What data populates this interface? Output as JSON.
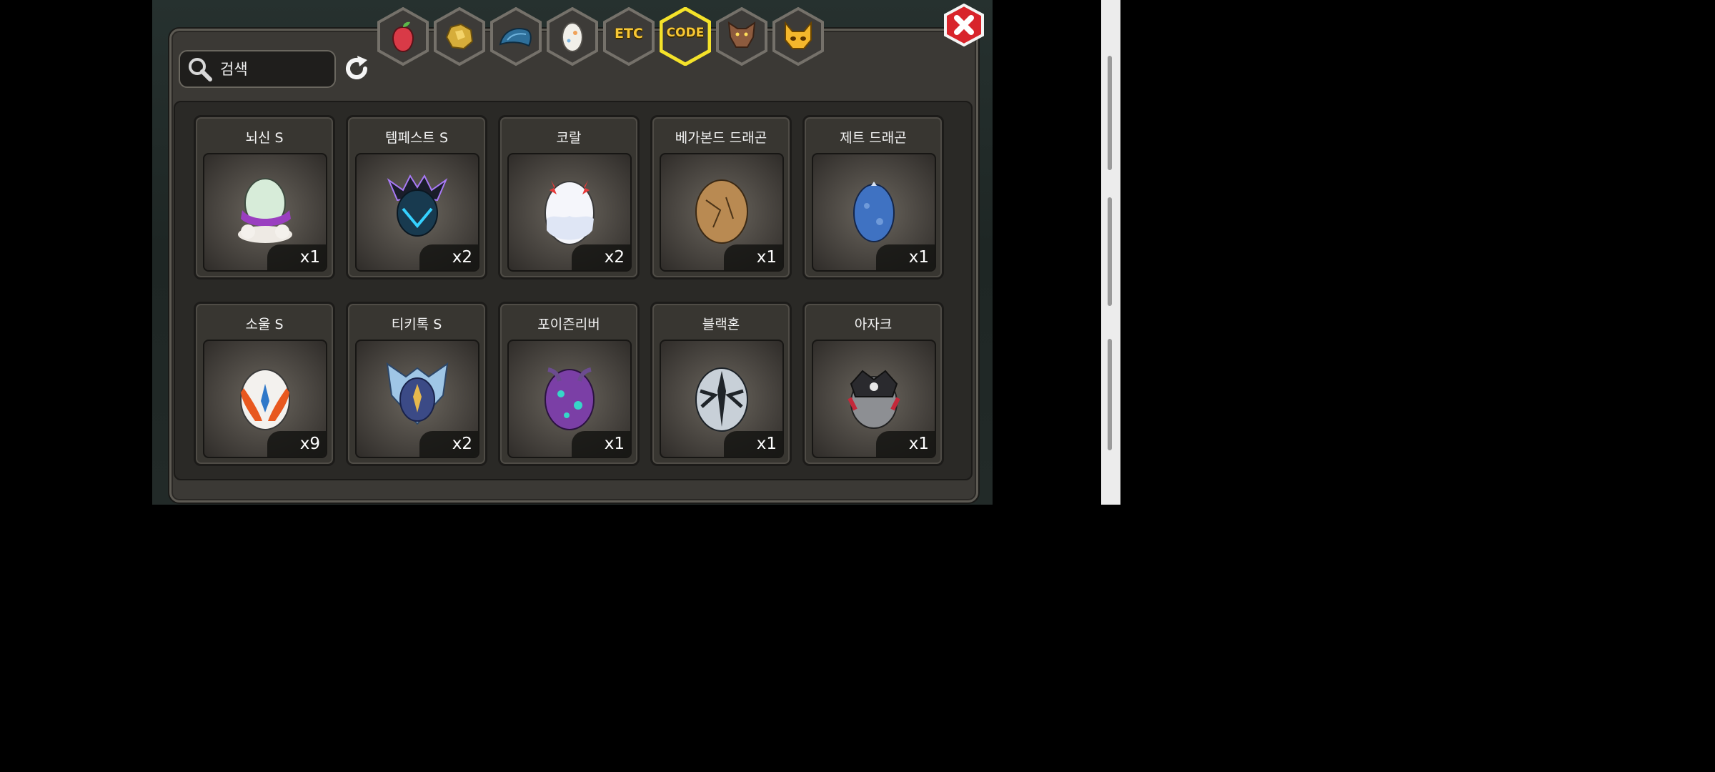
{
  "search": {
    "placeholder": "검색"
  },
  "tabs": [
    {
      "icon": "fruit-icon",
      "label": ""
    },
    {
      "icon": "gold-ore-icon",
      "label": ""
    },
    {
      "icon": "dragon-scale-icon",
      "label": ""
    },
    {
      "icon": "egg-icon",
      "label": ""
    },
    {
      "icon": "etc-icon",
      "label": "ETC"
    },
    {
      "icon": "code-icon",
      "label": "CODE",
      "active": true
    },
    {
      "icon": "wolf-head-icon",
      "label": ""
    },
    {
      "icon": "horned-mask-icon",
      "label": ""
    }
  ],
  "items": [
    {
      "name": "뇌신 S",
      "qty": "x1",
      "icon": "thunder-egg-icon"
    },
    {
      "name": "템페스트 S",
      "qty": "x2",
      "icon": "tempest-egg-icon"
    },
    {
      "name": "코랄",
      "qty": "x2",
      "icon": "coral-egg-icon"
    },
    {
      "name": "베가본드 드래곤",
      "qty": "x1",
      "icon": "vagabond-egg-icon"
    },
    {
      "name": "제트 드래곤",
      "qty": "x1",
      "icon": "jet-egg-icon"
    },
    {
      "name": "소울 S",
      "qty": "x9",
      "icon": "soul-egg-icon"
    },
    {
      "name": "티키톡 S",
      "qty": "x2",
      "icon": "tiktok-egg-icon"
    },
    {
      "name": "포이즌리버",
      "qty": "x1",
      "icon": "poison-river-egg-icon"
    },
    {
      "name": "블랙혼",
      "qty": "x1",
      "icon": "blackhorn-egg-icon"
    },
    {
      "name": "아자크",
      "qty": "x1",
      "icon": "azak-egg-icon"
    }
  ]
}
